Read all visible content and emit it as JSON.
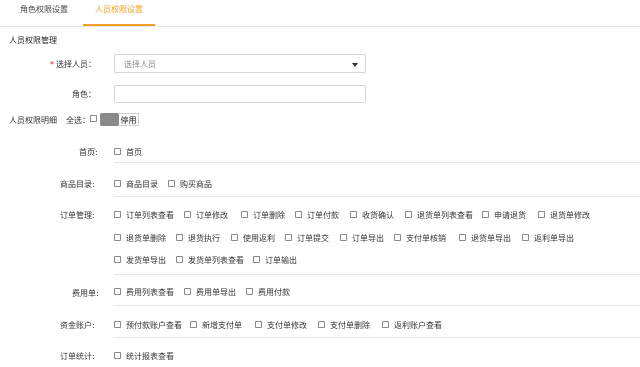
{
  "tabs": [
    {
      "label": "角色权限设置",
      "active": false
    },
    {
      "label": "人员权限设置",
      "active": true
    }
  ],
  "section_title": "人员权限管理",
  "form": {
    "person_label": "选择人员：",
    "person_placeholder": "选择人员",
    "role_label": "角色：",
    "role_value": ""
  },
  "detail": {
    "label": "人员权限明细",
    "select_all": "全选：",
    "toggle_label": "停用",
    "toggle_enabled": false
  },
  "groups": {
    "home": {
      "label": "首页:",
      "items": [
        "首页"
      ]
    },
    "goods": {
      "label": "商品目录:",
      "items": [
        "商品目录",
        "购买商品"
      ]
    },
    "orders": {
      "label": "订单管理:",
      "items": [
        "订单列表查看",
        "订单修改",
        "订单删除",
        "订单付款",
        "收货确认",
        "退货单列表查看",
        "申请退货",
        "退货单修改",
        "退货单删除",
        "退货执行",
        "使用返利",
        "订单提交",
        "订单导出",
        "支付单核销",
        "退货单导出",
        "返利单导出",
        "发货单导出",
        "发货单列表查看",
        "订单输出"
      ]
    },
    "expense": {
      "label": "费用单:",
      "items": [
        "费用列表查看",
        "费用单导出",
        "费用付款"
      ]
    },
    "funds": {
      "label": "资金账户:",
      "items": [
        "预付款账户查看",
        "新增支付单",
        "支付单修改",
        "支付单删除",
        "返利账户查看"
      ]
    },
    "stats": {
      "label": "订单统计:",
      "items": [
        "统计报表查看"
      ]
    }
  },
  "colors": {
    "accent": "#f0a020",
    "required": "#e02020",
    "toggle_knob": "#8a8a8a"
  }
}
